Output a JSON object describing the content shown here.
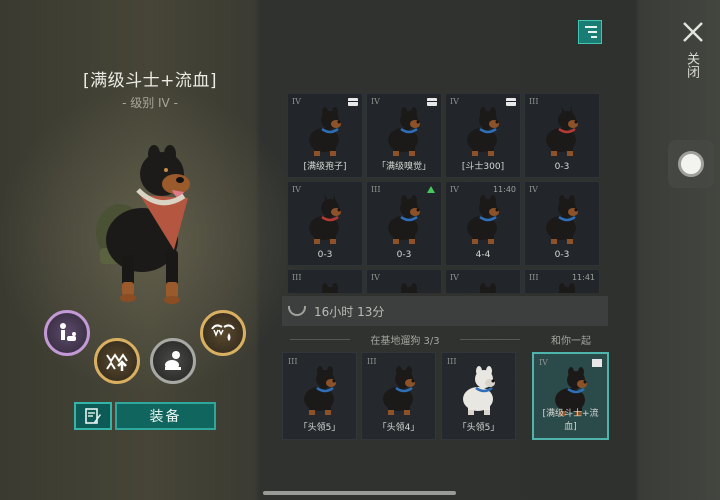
{
  "dog_panel": {
    "title": "[满级斗士+流血]",
    "level": "- 级别 IV -"
  },
  "skills": [
    {
      "icon": "handler-icon",
      "color": "purple"
    },
    {
      "icon": "jaw-upgrade-icon",
      "color": "gold"
    },
    {
      "icon": "sit-dog-icon",
      "color": "grey"
    },
    {
      "icon": "bleed-fangs-icon",
      "color": "gold"
    }
  ],
  "actions": {
    "equip_label": "装备"
  },
  "grid": {
    "cells": [
      {
        "tier": "IV",
        "label": "[满级孢子]",
        "chest": true,
        "coat": "rott"
      },
      {
        "tier": "IV",
        "label": "「满级嗅觉」",
        "chest": true,
        "coat": "rott"
      },
      {
        "tier": "IV",
        "label": "[斗士300]",
        "chest": true,
        "coat": "rott"
      },
      {
        "tier": "III",
        "label": "0-3",
        "coat": "dobie"
      },
      {
        "tier": "IV",
        "label": "0-3",
        "coat": "dobie"
      },
      {
        "tier": "III",
        "label": "0-3",
        "upgrade": true,
        "coat": "rott"
      },
      {
        "tier": "IV",
        "label": "4-4",
        "time": "11:40",
        "coat": "rott"
      },
      {
        "tier": "IV",
        "label": "0-3",
        "coat": "rott"
      },
      {
        "tier": "III",
        "label": "",
        "coat": "rott"
      },
      {
        "tier": "IV",
        "label": "",
        "coat": "rott"
      },
      {
        "tier": "IV",
        "label": "",
        "coat": "rott"
      },
      {
        "tier": "III",
        "label": "",
        "time": "11:41",
        "coat": "rott"
      }
    ]
  },
  "timer": {
    "text": "16小时 13分"
  },
  "base_section": {
    "title": "在基地遛狗",
    "count": "3/3",
    "with_you_label": "和你一起",
    "dogs": [
      {
        "tier": "III",
        "label": "「头领5」",
        "coat": "rott"
      },
      {
        "tier": "III",
        "label": "「头领4」",
        "coat": "rott"
      },
      {
        "tier": "III",
        "label": "「头领5」",
        "coat": "white"
      }
    ],
    "companion": {
      "tier": "IV",
      "label": "[满级斗士+流血]",
      "chest": true,
      "coat": "rott"
    }
  },
  "system": {
    "close_label": "关闭"
  },
  "colors": {
    "accent_teal": "#2fa79a",
    "collar_blue": "#2e6fb8",
    "collar_red": "#b83a34"
  }
}
